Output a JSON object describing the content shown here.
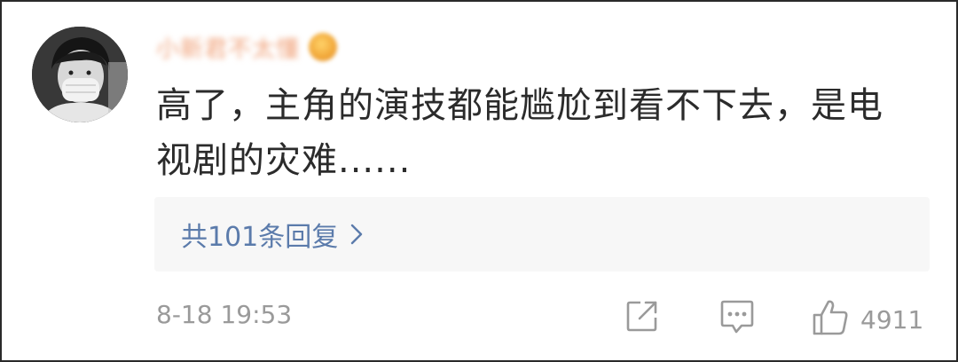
{
  "user": {
    "name": "小新君不太懂",
    "avatar_icon": "avatar-photo-masked-person"
  },
  "comment": {
    "line1": "高了，主角的演技都能尴尬到看不下去，是电",
    "line2": "视剧的灾难......"
  },
  "replies": {
    "label": "共101条回复",
    "chevron_icon": "chevron-right-icon"
  },
  "footer": {
    "timestamp": "8-18 19:53",
    "share_icon": "share-icon",
    "reply_icon": "comment-icon",
    "like_icon": "thumbs-up-icon",
    "like_count": "4911"
  },
  "colors": {
    "link": "#5b7bab",
    "muted": "#9a9a9a",
    "reply_bg": "#f7f7f7",
    "text": "#2b2b2b"
  }
}
